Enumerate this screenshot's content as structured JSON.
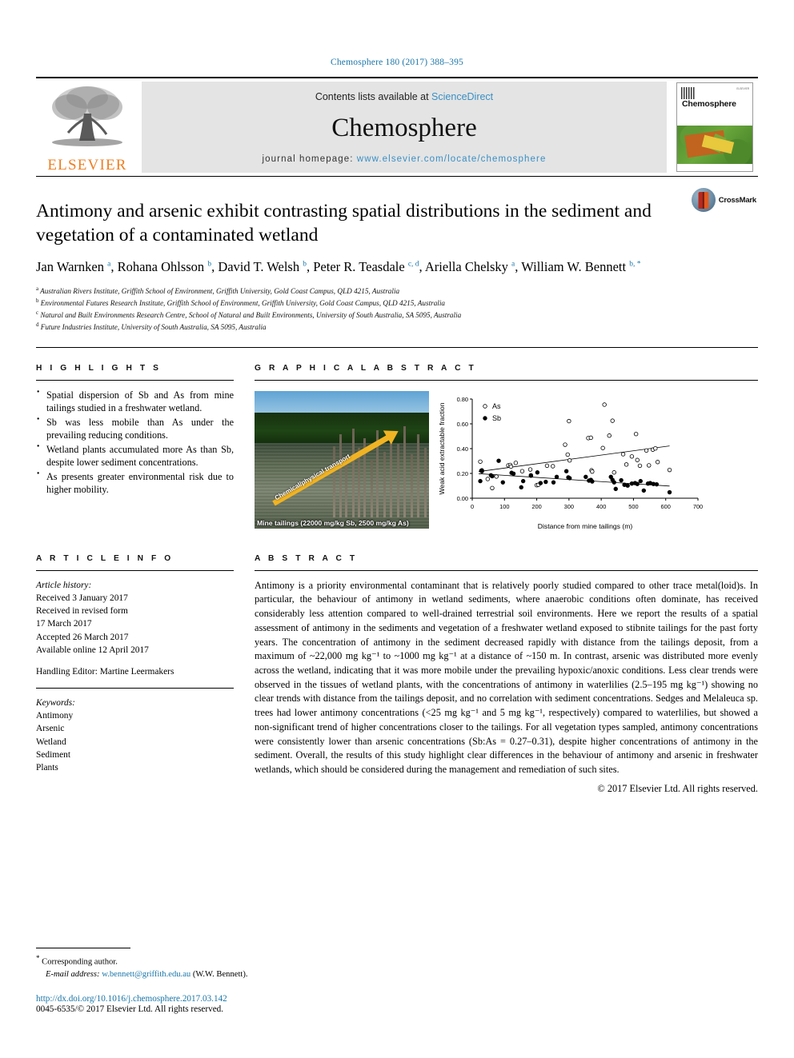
{
  "journal_ref": "Chemosphere 180 (2017) 388–395",
  "masthead": {
    "elsevier_wordmark": "ELSEVIER",
    "contents_prefix": "Contents lists available at ",
    "contents_link": "ScienceDirect",
    "journal_name": "Chemosphere",
    "homepage_prefix": "journal homepage: ",
    "homepage_url": "www.elsevier.com/locate/chemosphere",
    "cover_title": "Chemosphere",
    "cover_corner_text": "ELSEVIER"
  },
  "article": {
    "title": "Antimony and arsenic exhibit contrasting spatial distributions in the sediment and vegetation of a contaminated wetland",
    "crossmark_label": "CrossMark",
    "authors_html": "Jan Warnken <sup>a</sup>, Rohana Ohlsson <sup>b</sup>, David T. Welsh <sup>b</sup>, Peter R. Teasdale <sup>c, d</sup>, Ariella Chelsky <sup>a</sup>, William W. Bennett <sup>b, *</sup>",
    "affiliations": [
      {
        "marker": "a",
        "text": "Australian Rivers Institute, Griffith School of Environment, Griffith University, Gold Coast Campus, QLD 4215, Australia"
      },
      {
        "marker": "b",
        "text": "Environmental Futures Research Institute, Griffith School of Environment, Griffith University, Gold Coast Campus, QLD 4215, Australia"
      },
      {
        "marker": "c",
        "text": "Natural and Built Environments Research Centre, School of Natural and Built Environments, University of South Australia, SA 5095, Australia"
      },
      {
        "marker": "d",
        "text": "Future Industries Institute, University of South Australia, SA 5095, Australia"
      }
    ]
  },
  "highlights": {
    "heading": "H I G H L I G H T S",
    "items": [
      "Spatial dispersion of Sb and As from mine tailings studied in a freshwater wetland.",
      "Sb was less mobile than As under the prevailing reducing conditions.",
      "Wetland plants accumulated more As than Sb, despite lower sediment concentrations.",
      "As presents greater environmental risk due to higher mobility."
    ]
  },
  "graphical_abstract": {
    "heading": "G R A P H I C A L   A B S T R A C T",
    "photo": {
      "arrow_label": "Chemical/physical transport",
      "caption": "Mine tailings (22000 mg/kg Sb, 2500 mg/kg As)"
    }
  },
  "article_info": {
    "heading": "A R T I C L E   I N F O",
    "history_label": "Article history:",
    "history": [
      "Received 3 January 2017",
      "Received in revised form",
      "17 March 2017",
      "Accepted 26 March 2017",
      "Available online 12 April 2017"
    ],
    "handling_editor": "Handling Editor: Martine Leermakers",
    "keywords_label": "Keywords:",
    "keywords": [
      "Antimony",
      "Arsenic",
      "Wetland",
      "Sediment",
      "Plants"
    ]
  },
  "abstract": {
    "heading": "A B S T R A C T",
    "paragraphs": [
      "Antimony is a priority environmental contaminant that is relatively poorly studied compared to other trace metal(loid)s. In particular, the behaviour of antimony in wetland sediments, where anaerobic conditions often dominate, has received considerably less attention compared to well-drained terrestrial soil environments. Here we report the results of a spatial assessment of antimony in the sediments and vegetation of a freshwater wetland exposed to stibnite tailings for the past forty years. The concentration of antimony in the sediment decreased rapidly with distance from the tailings deposit, from a maximum of ~22,000 mg kg⁻¹ to ~1000 mg kg⁻¹ at a distance of ~150 m. In contrast, arsenic was distributed more evenly across the wetland, indicating that it was more mobile under the prevailing hypoxic/anoxic conditions. Less clear trends were observed in the tissues of wetland plants, with the concentrations of antimony in waterlilies (2.5–195 mg kg⁻¹) showing no clear trends with distance from the tailings deposit, and no correlation with sediment concentrations. Sedges and Melaleuca sp. trees had lower antimony concentrations (<25 mg kg⁻¹ and 5 mg kg⁻¹, respectively) compared to waterlilies, but showed a non-significant trend of higher concentrations closer to the tailings. For all vegetation types sampled, antimony concentrations were consistently lower than arsenic concentrations (Sb:As = 0.27–0.31), despite higher concentrations of antimony in the sediment. Overall, the results of this study highlight clear differences in the behaviour of antimony and arsenic in freshwater wetlands, which should be considered during the management and remediation of such sites."
    ],
    "copyright": "© 2017 Elsevier Ltd. All rights reserved."
  },
  "footer": {
    "corresponding_star": "*",
    "corresponding_label": "Corresponding author.",
    "email_label": "E-mail address:",
    "email": "w.bennett@griffith.edu.au",
    "email_suffix": "(W.W. Bennett).",
    "doi": "http://dx.doi.org/10.1016/j.chemosphere.2017.03.142",
    "issn": "0045-6535/© 2017 Elsevier Ltd. All rights reserved."
  },
  "chart_data": {
    "type": "scatter",
    "title": "",
    "xlabel": "Distance from mine tailings (m)",
    "ylabel": "Weak acid extractable fraction",
    "xlim": [
      0,
      700
    ],
    "ylim": [
      0.0,
      0.8
    ],
    "xticks": [
      0,
      100,
      200,
      300,
      400,
      500,
      600,
      700
    ],
    "yticks": [
      "0.00",
      "0.20",
      "0.40",
      "0.60",
      "0.80"
    ],
    "grid": false,
    "legend_position": "top-left",
    "legend": [
      {
        "name": "As",
        "marker": "open-circle"
      },
      {
        "name": "Sb",
        "marker": "filled-circle"
      }
    ],
    "series": [
      {
        "name": "As",
        "marker": "open-circle",
        "points": [
          [
            25,
            0.295
          ],
          [
            30,
            0.225
          ],
          [
            48,
            0.155
          ],
          [
            62,
            0.082
          ],
          [
            75,
            0.175
          ],
          [
            112,
            0.265
          ],
          [
            118,
            0.268
          ],
          [
            120,
            0.255
          ],
          [
            135,
            0.285
          ],
          [
            155,
            0.218
          ],
          [
            180,
            0.232
          ],
          [
            182,
            0.185
          ],
          [
            200,
            0.105
          ],
          [
            205,
            0.108
          ],
          [
            232,
            0.262
          ],
          [
            250,
            0.258
          ],
          [
            288,
            0.432
          ],
          [
            296,
            0.352
          ],
          [
            300,
            0.622
          ],
          [
            302,
            0.305
          ],
          [
            360,
            0.485
          ],
          [
            368,
            0.488
          ],
          [
            370,
            0.225
          ],
          [
            372,
            0.215
          ],
          [
            405,
            0.405
          ],
          [
            410,
            0.755
          ],
          [
            425,
            0.505
          ],
          [
            435,
            0.625
          ],
          [
            440,
            0.208
          ],
          [
            468,
            0.355
          ],
          [
            478,
            0.272
          ],
          [
            495,
            0.337
          ],
          [
            508,
            0.518
          ],
          [
            512,
            0.308
          ],
          [
            520,
            0.262
          ],
          [
            540,
            0.385
          ],
          [
            548,
            0.265
          ],
          [
            560,
            0.392
          ],
          [
            568,
            0.402
          ],
          [
            575,
            0.292
          ],
          [
            612,
            0.228
          ]
        ],
        "trendline": {
          "x": [
            20,
            612
          ],
          "y": [
            0.215,
            0.422
          ]
        }
      },
      {
        "name": "Sb",
        "marker": "filled-circle",
        "points": [
          [
            25,
            0.138
          ],
          [
            28,
            0.222
          ],
          [
            30,
            0.218
          ],
          [
            58,
            0.185
          ],
          [
            62,
            0.178
          ],
          [
            82,
            0.302
          ],
          [
            95,
            0.128
          ],
          [
            122,
            0.205
          ],
          [
            128,
            0.198
          ],
          [
            152,
            0.088
          ],
          [
            158,
            0.138
          ],
          [
            182,
            0.182
          ],
          [
            202,
            0.208
          ],
          [
            212,
            0.122
          ],
          [
            228,
            0.132
          ],
          [
            252,
            0.128
          ],
          [
            262,
            0.172
          ],
          [
            292,
            0.218
          ],
          [
            298,
            0.168
          ],
          [
            302,
            0.162
          ],
          [
            352,
            0.172
          ],
          [
            362,
            0.142
          ],
          [
            368,
            0.148
          ],
          [
            372,
            0.135
          ],
          [
            430,
            0.172
          ],
          [
            435,
            0.148
          ],
          [
            440,
            0.128
          ],
          [
            445,
            0.075
          ],
          [
            462,
            0.145
          ],
          [
            472,
            0.108
          ],
          [
            482,
            0.102
          ],
          [
            495,
            0.118
          ],
          [
            505,
            0.122
          ],
          [
            512,
            0.115
          ],
          [
            522,
            0.138
          ],
          [
            532,
            0.062
          ],
          [
            545,
            0.118
          ],
          [
            552,
            0.122
          ],
          [
            562,
            0.115
          ],
          [
            572,
            0.112
          ],
          [
            612,
            0.048
          ]
        ],
        "trendline": {
          "x": [
            20,
            612
          ],
          "y": [
            0.198,
            0.098
          ]
        }
      }
    ]
  }
}
